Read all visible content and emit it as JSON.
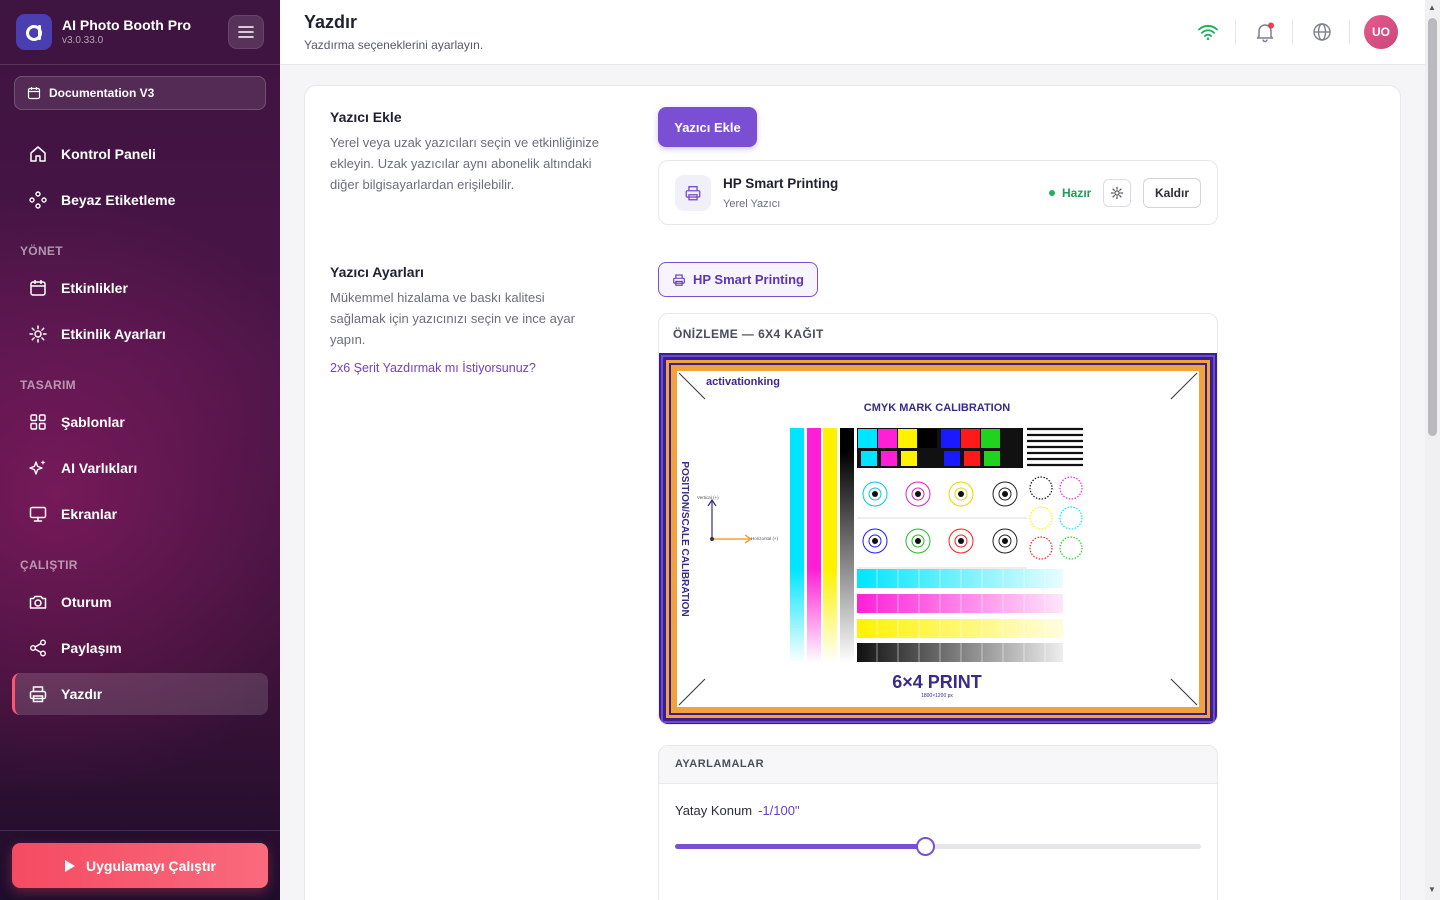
{
  "app": {
    "name": "AI Photo Booth Pro",
    "version": "v3.0.33.0"
  },
  "workspace": {
    "label": "Documentation V3"
  },
  "sidebar": {
    "top_items": [
      {
        "label": "Kontrol Paneli",
        "icon": "home-icon"
      },
      {
        "label": "Beyaz Etiketleme",
        "icon": "tag-icon"
      }
    ],
    "sections": [
      {
        "title": "YÖNET",
        "items": [
          {
            "label": "Etkinlikler",
            "icon": "calendar-icon"
          },
          {
            "label": "Etkinlik Ayarları",
            "icon": "gear-icon"
          }
        ]
      },
      {
        "title": "TASARIM",
        "items": [
          {
            "label": "Şablonlar",
            "icon": "grid-icon"
          },
          {
            "label": "AI Varlıkları",
            "icon": "sparkles-icon"
          },
          {
            "label": "Ekranlar",
            "icon": "monitor-icon"
          }
        ]
      },
      {
        "title": "ÇALIŞTIR",
        "items": [
          {
            "label": "Oturum",
            "icon": "camera-icon"
          },
          {
            "label": "Paylaşım",
            "icon": "share-icon"
          },
          {
            "label": "Yazdır",
            "icon": "printer-icon",
            "active": true
          }
        ]
      }
    ],
    "run_button": "Uygulamayı Çalıştır"
  },
  "header": {
    "title": "Yazdır",
    "subtitle": "Yazdırma seçeneklerini ayarlayın.",
    "avatar": "UO",
    "icons": [
      "wifi-icon",
      "bell-icon",
      "globe-icon"
    ]
  },
  "printer_add": {
    "title": "Yazıcı Ekle",
    "description": "Yerel veya uzak yazıcıları seçin ve etkinliğinize ekleyin. Uzak yazıcılar aynı abonelik altındaki diğer bilgisayarlardan erişilebilir.",
    "button": "Yazıcı Ekle",
    "printer": {
      "name": "HP Smart Printing",
      "type": "Yerel Yazıcı",
      "status": "Hazır",
      "remove": "Kaldır"
    }
  },
  "printer_settings": {
    "title": "Yazıcı Ayarları",
    "description": "Mükemmel hizalama ve baskı kalitesi sağlamak için yazıcınızı seçin ve ince ayar yapın.",
    "link": "2x6 Şerit Yazdırmak mı İstiyorsunuz?",
    "selected_printer": "HP Smart Printing",
    "preview_title": "ÖNİZLEME — 6X4 KAĞIT",
    "preview": {
      "brand": "activationking",
      "heading": "CMYK MARK CALIBRATION",
      "side_label": "POSITION/SCALE CALIBRATION",
      "vertical_label": "Vertical (+)",
      "horizontal_label": "Horizontal (+)",
      "print_label": "6×4 PRINT",
      "print_size": "1800×1200 px"
    },
    "adjustments": {
      "title": "AYARLAMALAR",
      "horizontal": {
        "label": "Yatay Konum",
        "value": "-1/100\"",
        "position": 0.475
      }
    }
  },
  "colors": {
    "accent": "#7b4fd4",
    "run": "#f44b62",
    "ready": "#1f9d55"
  }
}
